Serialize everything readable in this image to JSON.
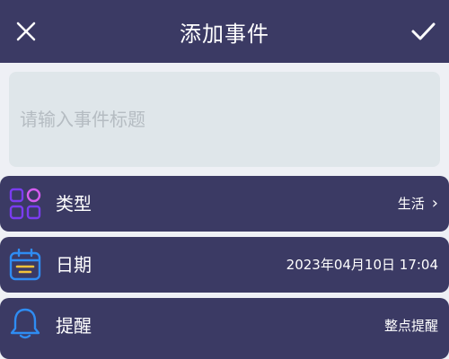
{
  "header": {
    "title": "添加事件",
    "close_icon": "close-icon",
    "confirm_icon": "checkmark-icon"
  },
  "title_input": {
    "placeholder": "请输入事件标题",
    "value": ""
  },
  "rows": [
    {
      "label": "类型",
      "value": "生活",
      "icon": "category-grid-icon",
      "chevron": "›"
    },
    {
      "label": "日期",
      "value": "2023年04月10日 17:04",
      "icon": "calendar-icon"
    },
    {
      "label": "提醒",
      "value": "整点提醒",
      "icon": "bell-icon"
    }
  ],
  "colors": {
    "header_bg": "#3b3a64",
    "row_bg": "#3b3a64",
    "input_bg": "#dfe6ea",
    "page_bg": "#eef0f5",
    "accent_purple": "#7a3cf0",
    "accent_pink": "#d65cf0",
    "calendar_blue": "#2f8cf2",
    "calendar_yellow": "#f2c23a",
    "bell_blue": "#2f8cf2"
  }
}
